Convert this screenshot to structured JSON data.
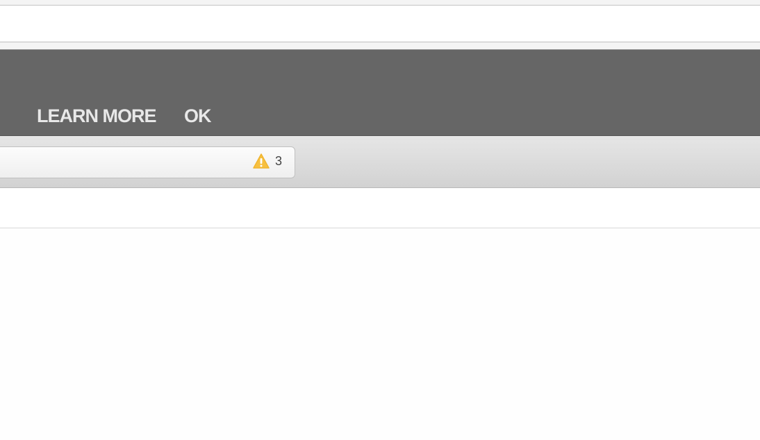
{
  "banner": {
    "learn_more_label": "LEARN MORE",
    "ok_label": "OK",
    "background": "#666666"
  },
  "toolbar": {
    "warning_icon": "warning-triangle-icon",
    "warning_count": "3",
    "warning_color": "#f7c040"
  }
}
